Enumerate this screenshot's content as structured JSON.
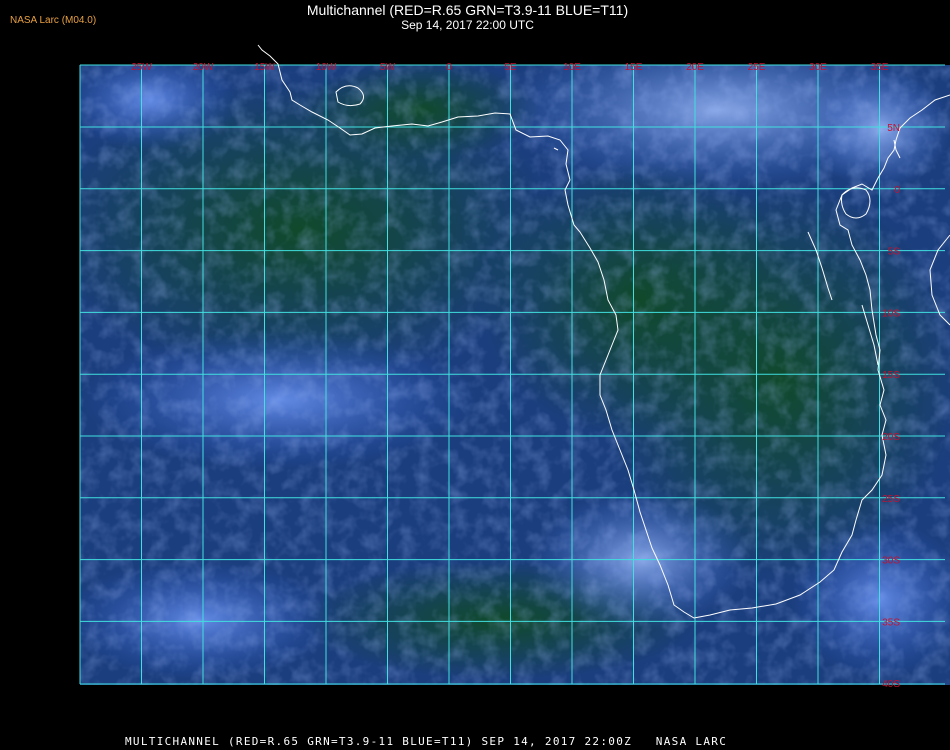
{
  "header": {
    "credit": "NASA Larc (M04.0)",
    "title": "Multichannel (RED=R.65 GRN=T3.9-11 BLUE=T11)",
    "subtitle": "Sep 14, 2017 22:00 UTC"
  },
  "footer": {
    "caption": "MULTICHANNEL (RED=R.65 GRN=T3.9-11 BLUE=T11) SEP 14, 2017 22:00Z   NASA LARC"
  },
  "map": {
    "lon_labels": [
      "25W",
      "20W",
      "15W",
      "10W",
      "5W",
      "0",
      "5E",
      "10E",
      "15E",
      "20E",
      "25E",
      "30E",
      "35E"
    ],
    "lat_labels": [
      "5N",
      "0",
      "5S",
      "10S",
      "15S",
      "20S",
      "25S",
      "30S",
      "35S",
      "40S"
    ],
    "colors": {
      "grid": "#40e0e0",
      "coastline": "#ffffff",
      "labels": "#c8102e",
      "ocean_dark": "#123a2a",
      "ocean_blue": "#1d3f8a",
      "cloud_blue": "#3a6fe0",
      "cloud_light": "#8fb0f5"
    }
  }
}
